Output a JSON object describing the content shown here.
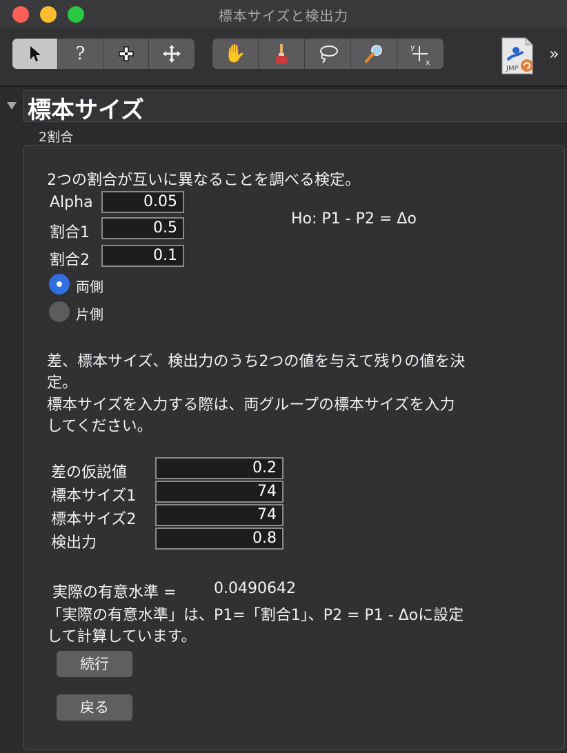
{
  "window": {
    "title": "標本サイズと検出力"
  },
  "toolbar": {
    "tools_left": [
      {
        "icon": "arrow-pointer-icon",
        "glyph": "➤"
      },
      {
        "icon": "help-question-icon",
        "glyph": "?"
      },
      {
        "icon": "selection-crosshair-icon",
        "glyph": "✚"
      },
      {
        "icon": "move-arrows-icon",
        "glyph": "✥"
      }
    ],
    "tools_right": [
      {
        "icon": "grabber-hand-icon",
        "glyph": "✋"
      },
      {
        "icon": "brush-icon",
        "glyph": "🖌"
      },
      {
        "icon": "lasso-icon",
        "glyph": "➰"
      },
      {
        "icon": "magnifier-icon",
        "glyph": "🔍"
      },
      {
        "icon": "crosshair-xy-icon",
        "glyph": "┼"
      }
    ],
    "jmp_label": "JMP",
    "more_glyph": "»"
  },
  "outline": {
    "title": "標本サイズ",
    "subtitle": "2割合"
  },
  "panel": {
    "intro": "2つの割合が互いに異なることを調べる検定。",
    "hypothesis": "Ho: P1 - P2 = Δo",
    "inputs": [
      {
        "label": "Alpha",
        "value": "0.05"
      },
      {
        "label": "割合1",
        "value": "0.5"
      },
      {
        "label": "割合2",
        "value": "0.1"
      }
    ],
    "sides": [
      {
        "label": "両側",
        "selected": true
      },
      {
        "label": "片側",
        "selected": false
      }
    ],
    "instructions": [
      "差、標本サイズ、検出力のうち2つの値を与えて残りの値を決",
      "定。",
      "標本サイズを入力する際は、両グループの標本サイズを入力",
      "してください。"
    ],
    "params": [
      {
        "label": "差の仮説値",
        "value": "0.2"
      },
      {
        "label": "標本サイズ1",
        "value": "74"
      },
      {
        "label": "標本サイズ2",
        "value": "74"
      },
      {
        "label": "検出力",
        "value": "0.8"
      }
    ],
    "actual_alpha_label": "実際の有意水準 =",
    "actual_alpha_value": "0.0490642",
    "note_lines": [
      "「実際の有意水準」は、P1=「割合1」、P2 = P1 - Δoに設定",
      "して計算しています。"
    ],
    "continue_button": "続行",
    "back_button": "戻る"
  }
}
